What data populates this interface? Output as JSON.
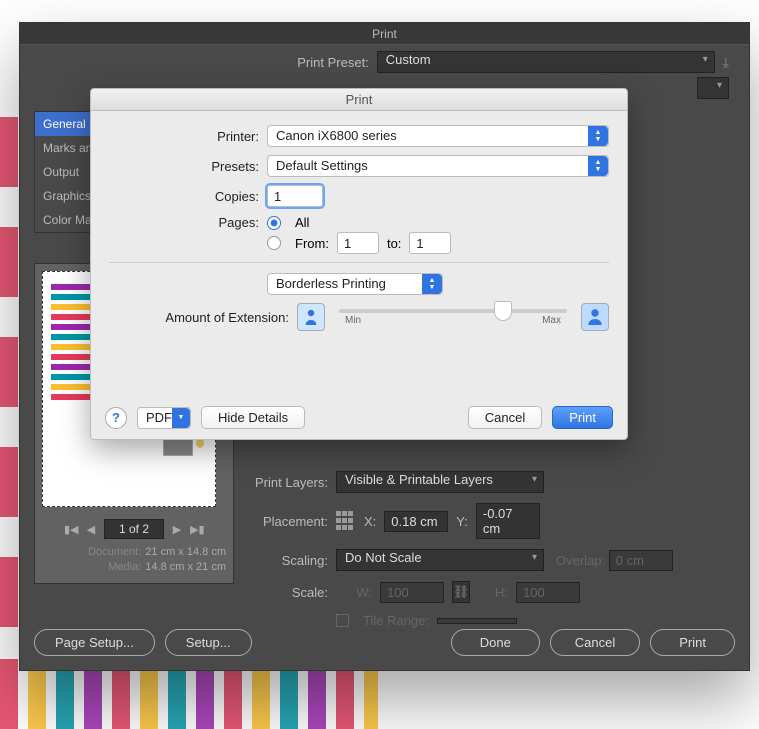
{
  "chrome": {
    "title": "Print",
    "preset_label": "Print Preset:",
    "preset_value": "Custom",
    "tabs": [
      "General",
      "Marks and Bleed",
      "Output",
      "Graphics",
      "Color Management"
    ],
    "tab_selected": 0,
    "pager": {
      "text": "1 of 2"
    },
    "doc_meta": {
      "document_label": "Document:",
      "document_value": "21 cm x 14.8 cm",
      "media_label": "Media:",
      "media_value": "14.8 cm x 21 cm"
    },
    "right": {
      "print_layers_label": "Print Layers:",
      "print_layers_value": "Visible & Printable Layers",
      "placement_label": "Placement:",
      "x_label": "X:",
      "x_value": "0.18 cm",
      "y_label": "Y:",
      "y_value": "-0.07 cm",
      "scaling_label": "Scaling:",
      "scaling_value": "Do Not Scale",
      "overlap_label": "Overlap:",
      "overlap_value": "0 cm",
      "scale_label": "Scale:",
      "w_label": "W:",
      "w_value": "100",
      "h_label": "H:",
      "h_value": "100",
      "tile_label": "Tile Range:"
    },
    "footer": {
      "page_setup": "Page Setup...",
      "setup": "Setup...",
      "done": "Done",
      "cancel": "Cancel",
      "print": "Print"
    }
  },
  "sheet": {
    "title": "Print",
    "printer_label": "Printer:",
    "printer_value": "Canon iX6800 series",
    "presets_label": "Presets:",
    "presets_value": "Default Settings",
    "copies_label": "Copies:",
    "copies_value": "1",
    "pages_label": "Pages:",
    "all_label": "All",
    "from_label": "From:",
    "from_value": "1",
    "to_label": "to:",
    "to_value": "1",
    "mode_value": "Borderless Printing",
    "extension_label": "Amount of Extension:",
    "min_label": "Min",
    "max_label": "Max",
    "pdf_label": "PDF",
    "hide_label": "Hide Details",
    "cancel_label": "Cancel",
    "print_label": "Print"
  }
}
